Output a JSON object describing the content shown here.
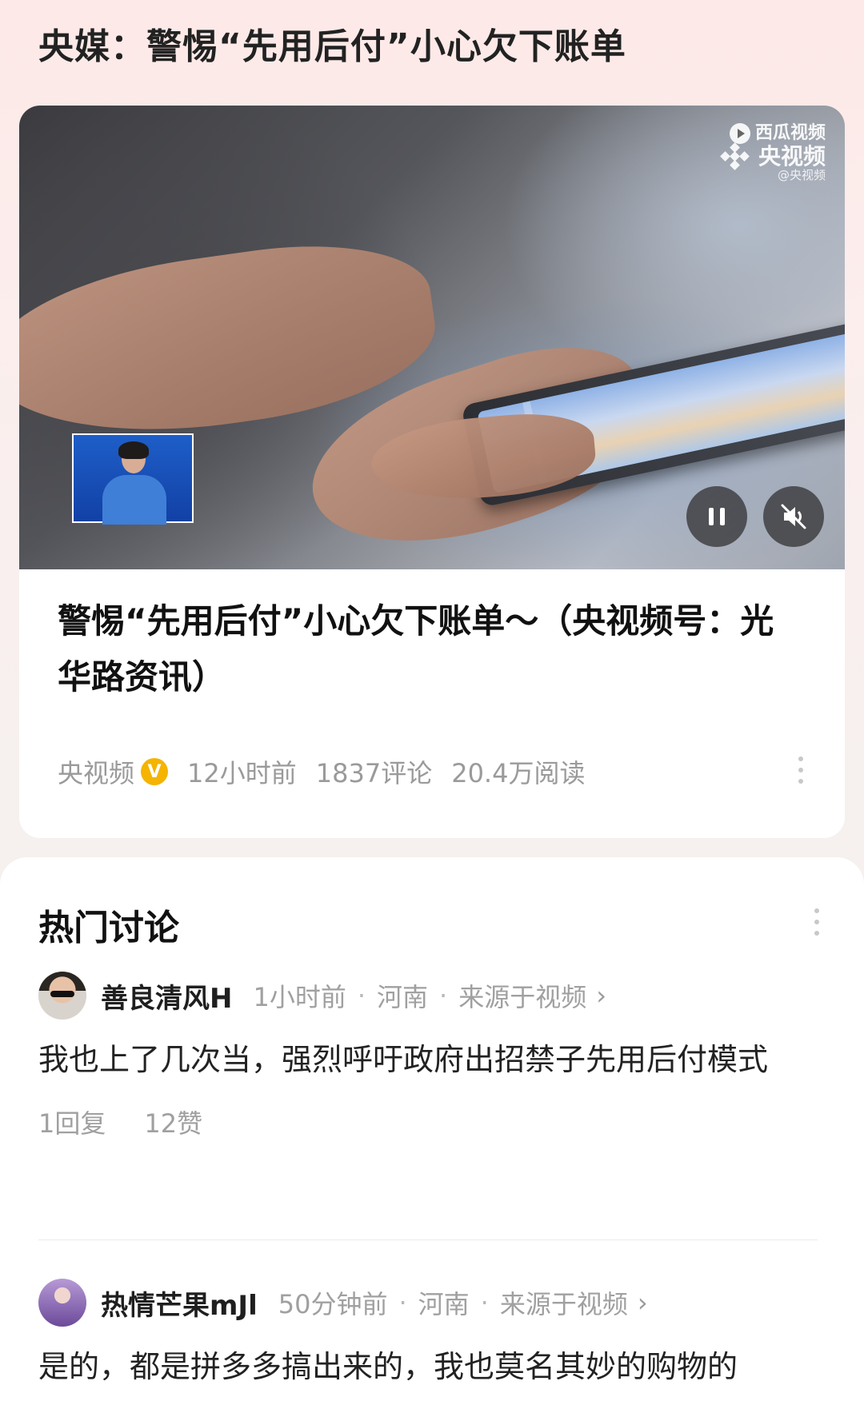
{
  "topic": {
    "title": "央媒：警惕“先用后付”小心欠下账单"
  },
  "video": {
    "watermark_brand": "西瓜视频",
    "watermark_logo": "央视频",
    "watermark_handle": "@央视频",
    "pause_icon": "pause-icon",
    "mute_icon": "speaker-muted-icon"
  },
  "card": {
    "caption": "警惕“先用后付”小心欠下账单～（央视频号：光华路资讯）",
    "source": "央视频",
    "verified_badge": "V",
    "time": "12小时前",
    "comments": "1837评论",
    "reads": "20.4万阅读"
  },
  "discussion": {
    "title": "热门讨论",
    "comments": [
      {
        "user": "善良清风H",
        "time": "1小时前",
        "location": "河南",
        "source": "来源于视频",
        "text": "我也上了几次当，强烈呼吁政府出招禁子先用后付模式",
        "replies": "1回复",
        "likes": "12赞"
      },
      {
        "user": "热情芒果mJl",
        "time": "50分钟前",
        "location": "河南",
        "source": "来源于视频",
        "text": "是的，都是拼多多搞出来的，我也莫名其妙的购物的"
      }
    ],
    "separator": "·",
    "chevron": "›"
  }
}
